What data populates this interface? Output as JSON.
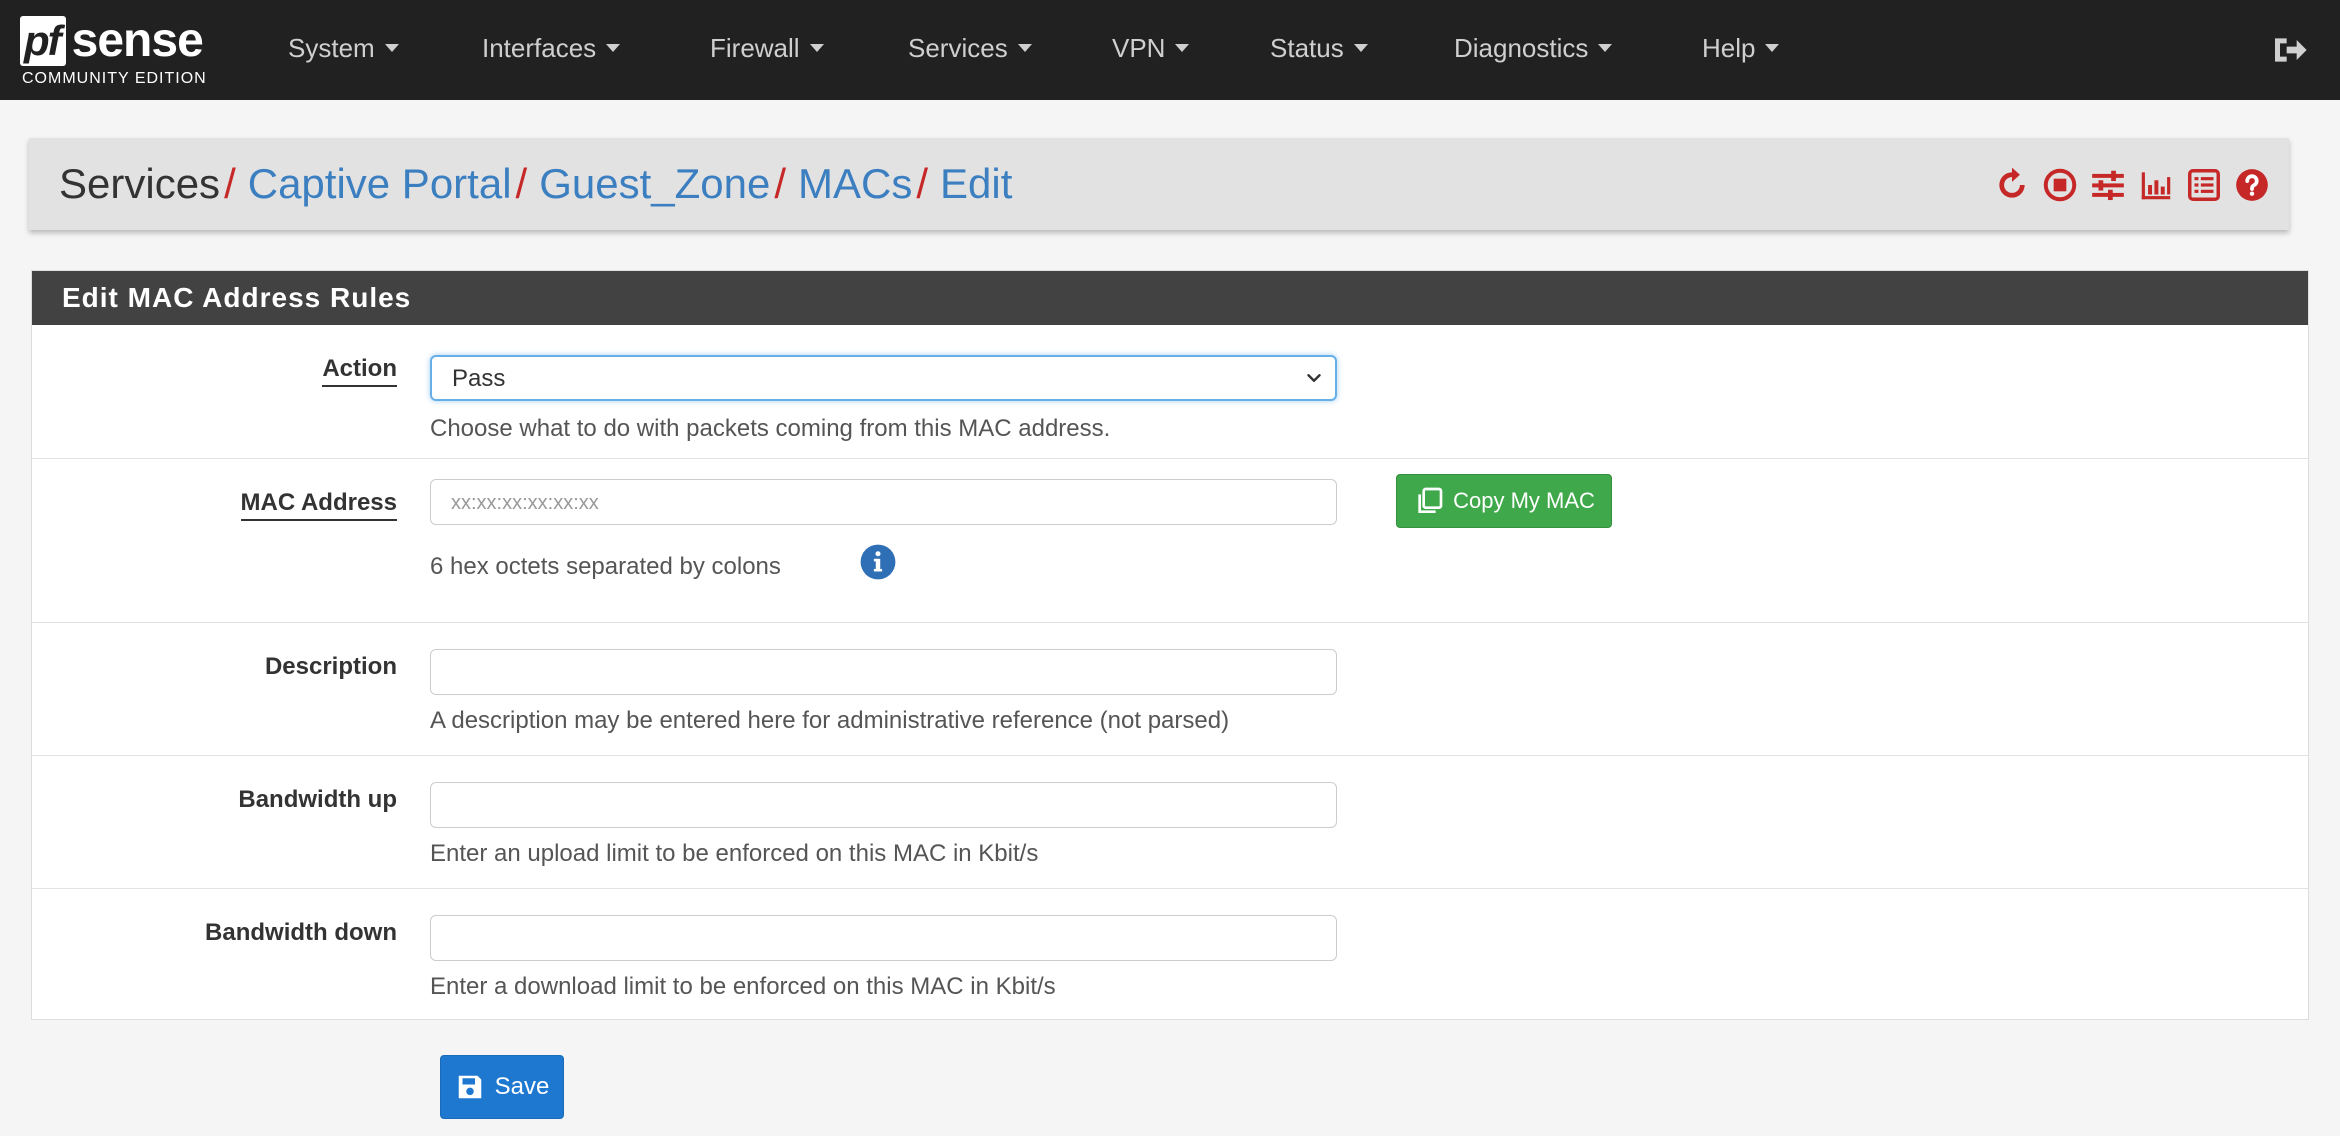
{
  "brand": {
    "logo_pf": "pf",
    "logo_sense": "sense",
    "edition": "COMMUNITY EDITION"
  },
  "nav": {
    "items": [
      {
        "label": "System"
      },
      {
        "label": "Interfaces"
      },
      {
        "label": "Firewall"
      },
      {
        "label": "Services"
      },
      {
        "label": "VPN"
      },
      {
        "label": "Status"
      },
      {
        "label": "Diagnostics"
      },
      {
        "label": "Help"
      }
    ],
    "logout_icon": "sign-out-icon"
  },
  "breadcrumb": {
    "root": "Services",
    "separator": "/",
    "links": [
      "Captive Portal",
      "Guest_Zone",
      "MACs",
      "Edit"
    ],
    "icons": [
      "restart-icon",
      "stop-icon",
      "settings-sliders-icon",
      "bar-chart-icon",
      "list-icon",
      "help-icon"
    ]
  },
  "panel": {
    "title": "Edit MAC Address Rules",
    "action": {
      "label": "Action",
      "value": "Pass",
      "help": "Choose what to do with packets coming from this MAC address."
    },
    "mac": {
      "label": "MAC Address",
      "placeholder": "xx:xx:xx:xx:xx:xx",
      "value": "",
      "copy_button": "Copy My MAC",
      "help": "6 hex octets separated by colons"
    },
    "description": {
      "label": "Description",
      "value": "",
      "help": "A description may be entered here for administrative reference (not parsed)"
    },
    "bw_up": {
      "label": "Bandwidth up",
      "value": "",
      "help": "Enter an upload limit to be enforced on this MAC in Kbit/s"
    },
    "bw_down": {
      "label": "Bandwidth down",
      "value": "",
      "help": "Enter a download limit to be enforced on this MAC in Kbit/s"
    }
  },
  "save_button": "Save",
  "colors": {
    "navbar": "#212121",
    "link": "#3c7fc0",
    "accent_red": "#c62828",
    "success": "#3fa84a",
    "primary": "#1e78d0"
  }
}
